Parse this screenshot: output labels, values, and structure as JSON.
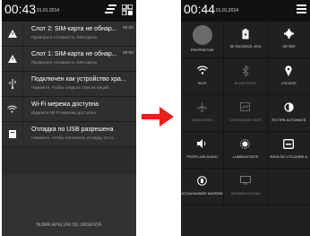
{
  "left_phone": {
    "status": {
      "time": "00:43",
      "date": "01.01.2014"
    },
    "notifications": [
      {
        "title": "Слот 2: SIM-карта не обнар...",
        "subtitle": "Проверьте готовность SIM-карты",
        "time": "00:00",
        "icon": "warning-icon"
      },
      {
        "title": "Слот 1: SIM-карта не обнар...",
        "subtitle": "Проверьте готовность SIM-карты",
        "time": "00:00",
        "icon": "warning-icon"
      },
      {
        "title": "Подключен как устройство хра...",
        "subtitle": "Нажмите, чтобы открыть список опций.",
        "time": "",
        "icon": "usb-icon"
      },
      {
        "title": "Wi-Fi мережа доступна",
        "subtitle": "Відкрити Wi-Fi мережу доступна",
        "time": "",
        "icon": "wifi-icon"
      },
      {
        "title": "Отладка по USB разрешена",
        "subtitle": "Нажмите, чтобы отключить отладку по U...",
        "time": "",
        "icon": "debug-icon"
      }
    ],
    "emergency_text": "NUMAI APELURI DE URGENȚĂ"
  },
  "right_phone": {
    "status": {
      "time": "00:44",
      "date": "01.01.2014"
    },
    "tiles": [
      [
        {
          "label": "PROPRIETAR",
          "icon": "avatar-icon"
        },
        {
          "label": "SE ÎNCARCĂ, 90%",
          "icon": "battery-icon"
        },
        {
          "label": "SETĂRI",
          "icon": "gear-icon"
        }
      ],
      [
        {
          "label": "WI-FI",
          "icon": "wifi-icon"
        },
        {
          "label": "BLUETOOTH",
          "icon": "bluetooth-icon"
        },
        {
          "label": "LOCAȚIE",
          "icon": "location-icon"
        }
      ],
      [
        {
          "label": "MOD AVION",
          "icon": "airplane-icon"
        },
        {
          "label": "CONEXIUNE DATE",
          "icon": "data-icon"
        },
        {
          "label": "ROTIRE AUTOMATĂ",
          "icon": "auto-rotate-icon"
        }
      ],
      [
        {
          "label": "PROFILURI AUDIO",
          "icon": "audio-profile-icon"
        },
        {
          "label": "LUMINOZITATE",
          "icon": "brightness-icon"
        },
        {
          "label": "RATA DE UTILIZARE A",
          "icon": "usage-rate-icon"
        }
      ],
      [
        {
          "label": "ECONOMISIRE BATERIE",
          "icon": "battery-saver-icon"
        },
        {
          "label": "AFIȘARE ECRAN",
          "icon": "screen-cast-icon"
        },
        {
          "label": "",
          "icon": ""
        }
      ]
    ]
  },
  "colors": {
    "arrow": "#e8201a"
  }
}
